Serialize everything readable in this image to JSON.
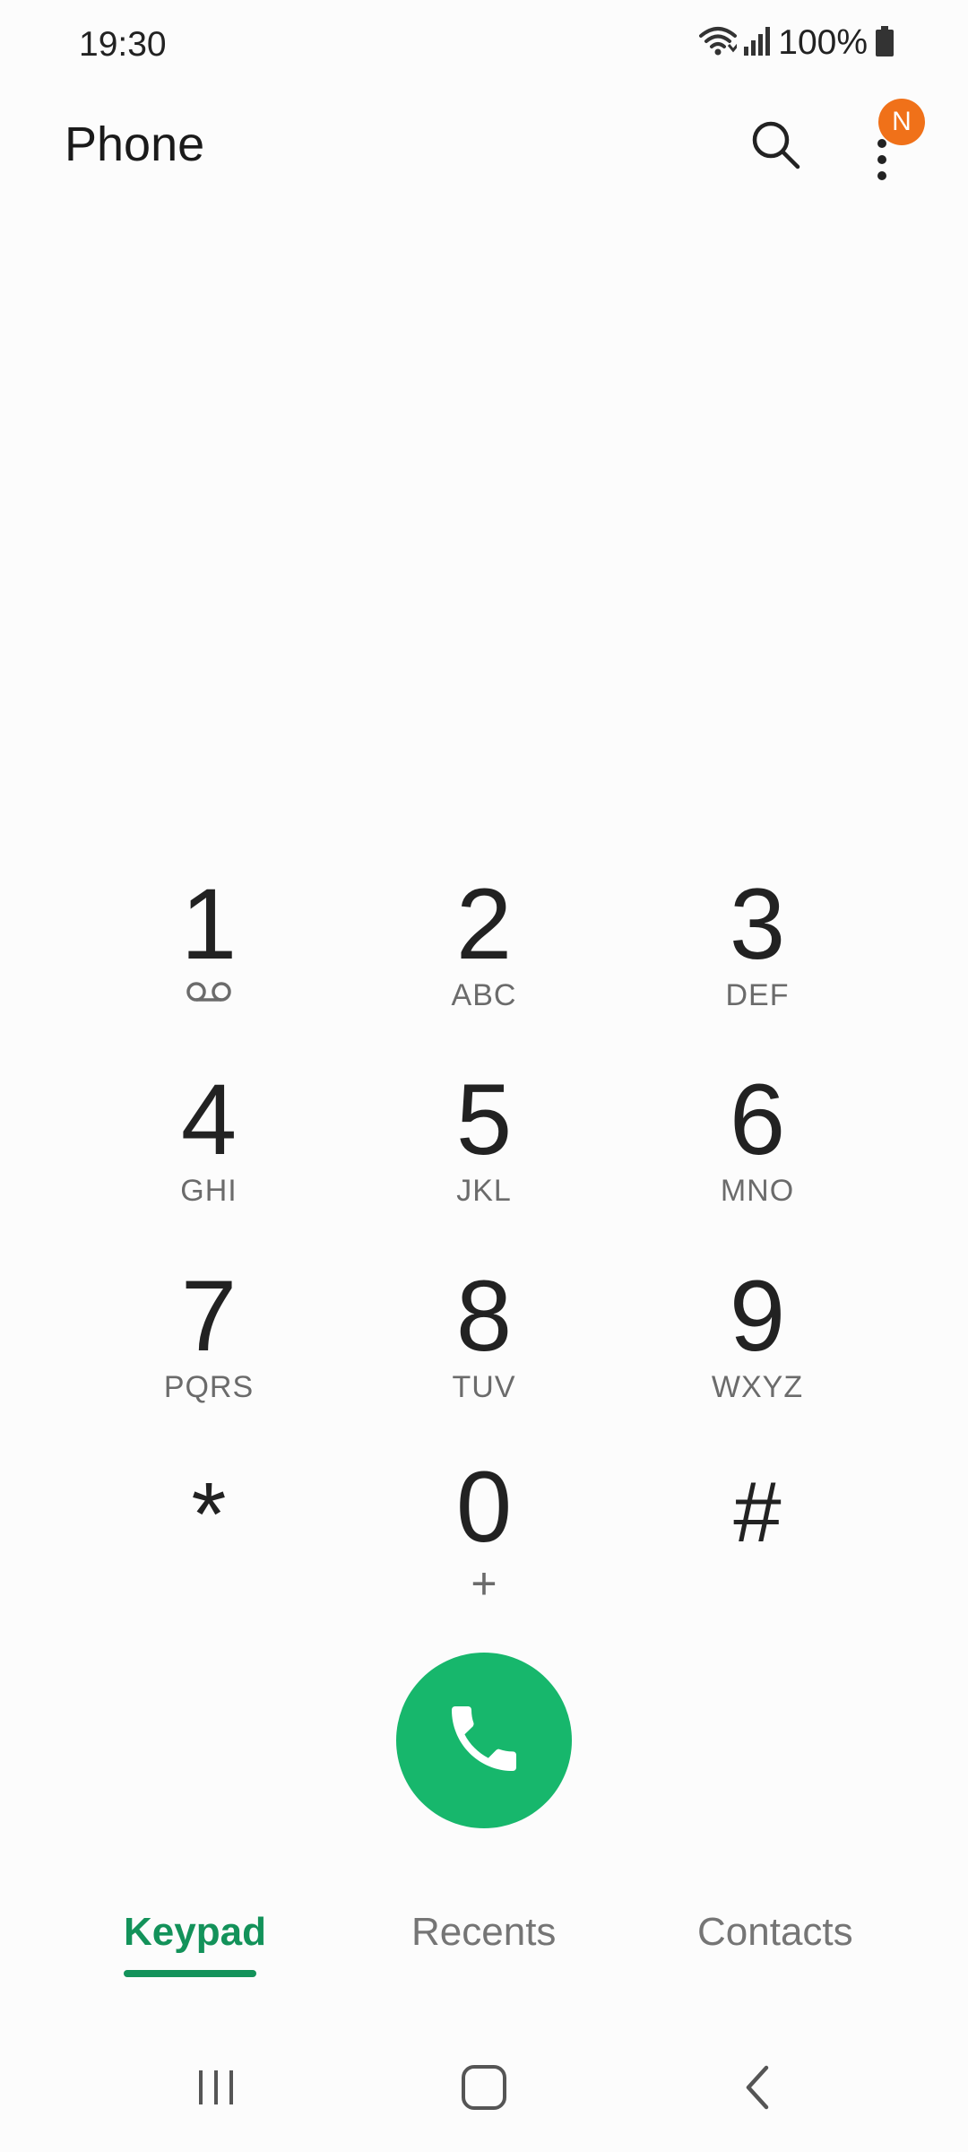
{
  "status_bar": {
    "time": "19:30",
    "battery_percent": "100%",
    "icons": [
      "wifi-icon",
      "signal-icon",
      "battery-icon"
    ]
  },
  "header": {
    "title": "Phone",
    "notification_badge": "N",
    "icons": [
      "search-icon",
      "more-vert-icon"
    ]
  },
  "keypad": {
    "keys": [
      {
        "digit": "1",
        "sub": "",
        "sub_icon": "voicemail-icon"
      },
      {
        "digit": "2",
        "sub": "ABC"
      },
      {
        "digit": "3",
        "sub": "DEF"
      },
      {
        "digit": "4",
        "sub": "GHI"
      },
      {
        "digit": "5",
        "sub": "JKL"
      },
      {
        "digit": "6",
        "sub": "MNO"
      },
      {
        "digit": "7",
        "sub": "PQRS"
      },
      {
        "digit": "8",
        "sub": "TUV"
      },
      {
        "digit": "9",
        "sub": "WXYZ"
      },
      {
        "digit": "*",
        "sub": ""
      },
      {
        "digit": "0",
        "sub": "+"
      },
      {
        "digit": "#",
        "sub": ""
      }
    ]
  },
  "call_button": {
    "icon": "phone-call-icon",
    "color": "#17b76c"
  },
  "tabs": [
    {
      "label": "Keypad",
      "active": true
    },
    {
      "label": "Recents",
      "active": false
    },
    {
      "label": "Contacts",
      "active": false
    }
  ],
  "nav_bar": {
    "icons": [
      "recent-apps-icon",
      "home-icon",
      "back-icon"
    ]
  },
  "colors": {
    "accent": "#13925a",
    "badge": "#f07119"
  }
}
